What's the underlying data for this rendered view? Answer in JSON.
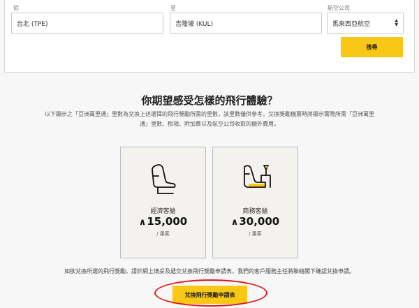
{
  "search": {
    "from_label": "從",
    "from_value": "台北 (TPE)",
    "to_label": "至",
    "to_value": "吉隆坡 (KUL)",
    "airline_label": "航空公司",
    "airline_value": "馬來西亞航空",
    "search_button": "搜尋"
  },
  "experience": {
    "headline": "你期望感受怎樣的飛行體驗？",
    "intro": "以下顯示之「亞洲萬里通」里數為兌換上述選擇的飛行獎勵所需的里數，該里數僅供參考。兌換獎勵機票時將顯示實際所需「亞洲萬里通」里數、稅項、附加費以及航空公司收取的額外費用。",
    "cards": [
      {
        "icon": "economy-seat-icon",
        "name": "經濟客艙",
        "miles": "15,000",
        "unit": "/ 乘客"
      },
      {
        "icon": "business-seat-icon",
        "name": "商務客艙",
        "miles": "30,000",
        "unit": "/ 乘客"
      }
    ],
    "note": "如欲兌換所選的飛行獎勵，請於網上填妥及遞交兌換飛行獎勵申請表，我們的客戶服務主任將聯絡閣下確認兌換申請。",
    "redeem_button": "兌換飛行獎勵申請表"
  },
  "colors": {
    "accent": "#f9c715",
    "highlight": "#e0161a"
  }
}
